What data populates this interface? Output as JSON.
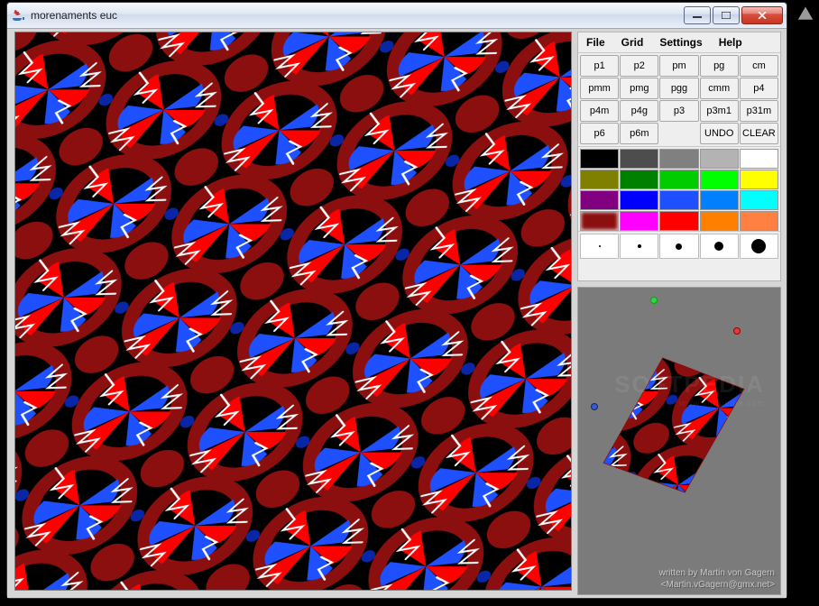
{
  "window": {
    "title": "morenaments euc"
  },
  "menus": {
    "file": "File",
    "grid": "Grid",
    "settings": "Settings",
    "help": "Help"
  },
  "symmetry": {
    "row1": [
      "p1",
      "p2",
      "pm",
      "pg",
      "cm"
    ],
    "row2": [
      "pmm",
      "pmg",
      "pgg",
      "cmm",
      "p4"
    ],
    "row3": [
      "p4m",
      "p4g",
      "p3",
      "p3m1",
      "p31m"
    ],
    "row4": [
      "p6",
      "p6m",
      "",
      "UNDO",
      "CLEAR"
    ]
  },
  "palette": [
    [
      "#000000",
      "#4d4d4d",
      "#808080",
      "#b3b3b3",
      "#ffffff"
    ],
    [
      "#808000",
      "#008000",
      "#00cc00",
      "#00ff00",
      "#ffff00"
    ],
    [
      "#800080",
      "#0000ff",
      "#1e50ff",
      "#0080ff",
      "#00ffff"
    ],
    [
      "#8b0f0f",
      "#ff00ff",
      "#ff0000",
      "#ff8000",
      "#ff8040"
    ]
  ],
  "selected_color_index": [
    3,
    0
  ],
  "brush_sizes": [
    2,
    4,
    7,
    10,
    16
  ],
  "preview_credits_line1": "written by Martin von Gagern",
  "preview_credits_line2": "<Martin.vGagern@gmx.net>",
  "watermark": "SOFTPEDIA",
  "watermark_sub": "www.softpedia.com"
}
